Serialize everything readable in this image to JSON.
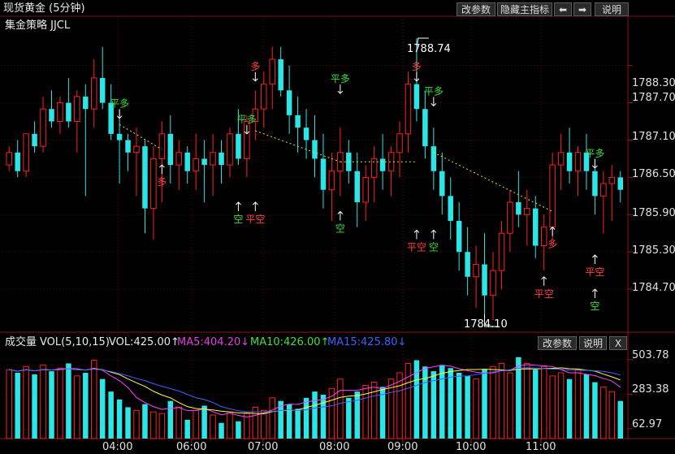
{
  "header": {
    "title": "现货黄金 (5分钟)",
    "buttons": {
      "change_params": "改参数",
      "hide_main": "隐藏主指标",
      "prev": "⬅",
      "next": "➡",
      "help": "说明"
    }
  },
  "strategy": {
    "label": "集金策略 JJCL"
  },
  "price_axis": {
    "ticks": [
      "1788.30",
      "1787.70",
      "1787.10",
      "1786.50",
      "1785.90",
      "1785.30",
      "1784.70"
    ]
  },
  "annotations": {
    "high": "1788.74",
    "low": "1784.10"
  },
  "volume": {
    "title": "成交量",
    "indicator": "VOL(5,10,15)",
    "vol": "VOL:425.00↑",
    "ma5": "MA5:404.20↓",
    "ma10": "MA10:426.00↑",
    "ma15": "MA15:425.80↓",
    "buttons": {
      "change_params": "改参数",
      "help": "说明",
      "close": "X"
    },
    "ticks": [
      "503.78",
      "283.38",
      "62.97"
    ]
  },
  "time_axis": {
    "labels": [
      "04:00",
      "06:00",
      "07:00",
      "08:00",
      "09:00",
      "10:00",
      "11:00"
    ]
  },
  "signals": [
    {
      "text": "平多",
      "color": "#3ddc3d",
      "candle": 13,
      "dir": "down",
      "price": 1787.45
    },
    {
      "text": "多",
      "color": "#ff4040",
      "candle": 18,
      "dir": "up",
      "price": 1786.7
    },
    {
      "text": "空",
      "color": "#3ddc3d",
      "candle": 27,
      "dir": "up",
      "price": 1786.1
    },
    {
      "text": "平空",
      "color": "#ff4040",
      "candle": 29,
      "dir": "up",
      "price": 1786.1
    },
    {
      "text": "平多",
      "color": "#3ddc3d",
      "candle": 28,
      "dir": "down",
      "price": 1787.2
    },
    {
      "text": "多",
      "color": "#ff4040",
      "candle": 29,
      "dir": "down",
      "price": 1788.05
    },
    {
      "text": "平多",
      "color": "#3ddc3d",
      "candle": 39,
      "dir": "down",
      "price": 1787.85
    },
    {
      "text": "空",
      "color": "#3ddc3d",
      "candle": 39,
      "dir": "up",
      "price": 1785.95
    },
    {
      "text": "多",
      "color": "#ff4040",
      "candle": 48,
      "dir": "down",
      "price": 1788.05
    },
    {
      "text": "平空",
      "color": "#ff4040",
      "candle": 48,
      "dir": "up",
      "price": 1785.65
    },
    {
      "text": "平多",
      "color": "#3ddc3d",
      "candle": 50,
      "dir": "down",
      "price": 1787.65
    },
    {
      "text": "空",
      "color": "#3ddc3d",
      "candle": 50,
      "dir": "up",
      "price": 1785.65
    },
    {
      "text": "平空",
      "color": "#ff4040",
      "candle": 63,
      "dir": "up",
      "price": 1784.9
    },
    {
      "text": "多",
      "color": "#ff4040",
      "candle": 64,
      "dir": "up",
      "price": 1785.7
    },
    {
      "text": "平多",
      "color": "#3ddc3d",
      "candle": 69,
      "dir": "down",
      "price": 1786.65
    },
    {
      "text": "平空",
      "color": "#ff4040",
      "candle": 69,
      "dir": "up",
      "price": 1785.25
    },
    {
      "text": "空",
      "color": "#3ddc3d",
      "candle": 69,
      "dir": "up",
      "price": 1784.7
    }
  ],
  "chart_data": {
    "type": "candlestick",
    "y_axis_range": [
      1784.1,
      1788.74
    ],
    "volume_axis_range": [
      0,
      560
    ],
    "time_ticks": [
      "04:00",
      "06:00",
      "07:00",
      "08:00",
      "09:00",
      "10:00",
      "11:00"
    ],
    "candles": [
      [
        1786.7,
        1787.0,
        1786.6,
        1786.9
      ],
      [
        1786.9,
        1787.1,
        1786.5,
        1786.6
      ],
      [
        1786.6,
        1787.2,
        1786.5,
        1787.2
      ],
      [
        1787.2,
        1787.4,
        1786.9,
        1787.0
      ],
      [
        1787.0,
        1787.8,
        1786.9,
        1787.6
      ],
      [
        1787.6,
        1787.9,
        1787.3,
        1787.4
      ],
      [
        1787.4,
        1787.8,
        1787.2,
        1787.7
      ],
      [
        1787.7,
        1788.1,
        1787.3,
        1787.4
      ],
      [
        1787.4,
        1787.9,
        1786.9,
        1787.8
      ],
      [
        1787.8,
        1788.0,
        1786.2,
        1787.6
      ],
      [
        1787.6,
        1788.4,
        1787.3,
        1788.1
      ],
      [
        1788.1,
        1788.6,
        1787.6,
        1787.7
      ],
      [
        1787.7,
        1788.0,
        1787.1,
        1787.2
      ],
      [
        1787.2,
        1787.6,
        1786.4,
        1787.1
      ],
      [
        1787.1,
        1787.2,
        1786.6,
        1786.9
      ],
      [
        1786.9,
        1787.3,
        1786.2,
        1787.0
      ],
      [
        1787.0,
        1787.1,
        1785.6,
        1786.0
      ],
      [
        1786.0,
        1787.0,
        1785.5,
        1786.8
      ],
      [
        1786.8,
        1787.4,
        1786.1,
        1787.2
      ],
      [
        1787.2,
        1787.5,
        1786.4,
        1786.7
      ],
      [
        1786.7,
        1787.1,
        1786.3,
        1786.9
      ],
      [
        1786.9,
        1787.0,
        1786.4,
        1786.6
      ],
      [
        1786.6,
        1787.2,
        1786.3,
        1786.8
      ],
      [
        1786.8,
        1787.1,
        1786.1,
        1786.7
      ],
      [
        1786.7,
        1787.2,
        1786.2,
        1786.9
      ],
      [
        1786.9,
        1787.1,
        1786.4,
        1786.7
      ],
      [
        1786.7,
        1787.3,
        1786.5,
        1787.2
      ],
      [
        1787.2,
        1787.6,
        1786.7,
        1786.8
      ],
      [
        1786.8,
        1787.5,
        1786.5,
        1787.4
      ],
      [
        1787.4,
        1787.9,
        1787.1,
        1787.6
      ],
      [
        1787.6,
        1788.2,
        1787.3,
        1788.0
      ],
      [
        1788.0,
        1788.6,
        1787.6,
        1788.4
      ],
      [
        1788.4,
        1788.6,
        1787.8,
        1787.9
      ],
      [
        1787.9,
        1788.3,
        1787.2,
        1787.5
      ],
      [
        1787.5,
        1787.8,
        1786.9,
        1787.3
      ],
      [
        1787.3,
        1787.6,
        1786.8,
        1787.1
      ],
      [
        1787.1,
        1787.5,
        1786.5,
        1786.8
      ],
      [
        1786.8,
        1787.2,
        1786.0,
        1786.3
      ],
      [
        1786.3,
        1786.9,
        1785.8,
        1786.6
      ],
      [
        1786.6,
        1787.3,
        1786.2,
        1786.9
      ],
      [
        1786.9,
        1787.1,
        1786.4,
        1786.6
      ],
      [
        1786.6,
        1786.9,
        1785.7,
        1786.1
      ],
      [
        1786.1,
        1786.7,
        1785.8,
        1786.5
      ],
      [
        1786.5,
        1787.0,
        1786.1,
        1786.8
      ],
      [
        1786.8,
        1787.2,
        1786.3,
        1786.6
      ],
      [
        1786.6,
        1787.0,
        1786.2,
        1786.9
      ],
      [
        1786.9,
        1787.4,
        1786.5,
        1787.2
      ],
      [
        1787.2,
        1788.2,
        1786.9,
        1788.0
      ],
      [
        1788.0,
        1788.74,
        1787.4,
        1787.6
      ],
      [
        1787.6,
        1787.9,
        1786.8,
        1787.0
      ],
      [
        1787.0,
        1787.3,
        1786.3,
        1786.6
      ],
      [
        1786.6,
        1786.9,
        1785.9,
        1786.2
      ],
      [
        1786.2,
        1786.5,
        1785.5,
        1785.8
      ],
      [
        1785.8,
        1786.1,
        1785.0,
        1785.3
      ],
      [
        1785.3,
        1785.7,
        1784.6,
        1784.9
      ],
      [
        1784.9,
        1785.4,
        1784.4,
        1785.1
      ],
      [
        1785.1,
        1785.6,
        1784.1,
        1784.6
      ],
      [
        1784.6,
        1785.3,
        1784.2,
        1785.0
      ],
      [
        1785.0,
        1785.8,
        1784.7,
        1785.6
      ],
      [
        1785.6,
        1786.3,
        1785.3,
        1786.1
      ],
      [
        1786.1,
        1786.6,
        1785.7,
        1785.9
      ],
      [
        1785.9,
        1786.3,
        1785.4,
        1786.0
      ],
      [
        1786.0,
        1786.2,
        1785.2,
        1785.4
      ],
      [
        1785.4,
        1785.9,
        1785.0,
        1785.7
      ],
      [
        1785.7,
        1786.9,
        1785.5,
        1786.7
      ],
      [
        1786.7,
        1787.2,
        1786.3,
        1786.9
      ],
      [
        1786.9,
        1787.3,
        1786.4,
        1786.6
      ],
      [
        1786.6,
        1787.0,
        1786.2,
        1786.9
      ],
      [
        1786.9,
        1787.2,
        1786.3,
        1786.6
      ],
      [
        1786.6,
        1786.8,
        1785.9,
        1786.2
      ],
      [
        1786.2,
        1786.6,
        1785.6,
        1786.4
      ],
      [
        1786.4,
        1786.7,
        1785.8,
        1786.5
      ],
      [
        1786.5,
        1786.6,
        1786.1,
        1786.3
      ]
    ],
    "volumes": [
      440,
      420,
      460,
      410,
      470,
      430,
      450,
      480,
      400,
      420,
      500,
      380,
      300,
      250,
      200,
      180,
      220,
      170,
      160,
      240,
      200,
      120,
      180,
      210,
      150,
      100,
      170,
      110,
      160,
      200,
      180,
      260,
      240,
      220,
      190,
      260,
      300,
      280,
      320,
      380,
      260,
      300,
      340,
      360,
      330,
      380,
      420,
      480,
      500,
      460,
      430,
      470,
      450,
      420,
      400,
      380,
      440,
      460,
      480,
      420,
      520,
      480,
      440,
      460,
      400,
      420,
      380,
      440,
      410,
      360,
      330,
      300,
      240
    ]
  }
}
